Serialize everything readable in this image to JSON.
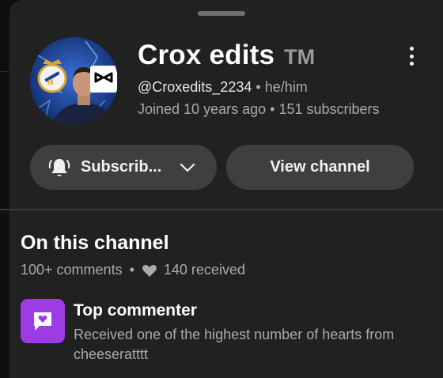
{
  "channel": {
    "name": "Crox edits",
    "tm": "TM",
    "handle": "@Croxedits_2234",
    "separator": "•",
    "pronouns": "he/him",
    "joined": "Joined 10 years ago",
    "subscribers": "151 subscribers",
    "avatar_badge_icon": "capcut-logo-icon"
  },
  "actions": {
    "subscribe_label": "Subscrib...",
    "view_label": "View channel"
  },
  "on_channel": {
    "title": "On this channel",
    "comments": "100+ comments",
    "dot": "•",
    "hearts": "140 received"
  },
  "badge": {
    "title": "Top commenter",
    "description": "Received one of the highest number of hearts from cheeseratttt",
    "color": "#9b3ce6"
  },
  "colors": {
    "sheet": "#212121",
    "button": "#3f3f3f",
    "secondary_text": "#aaaaaa"
  }
}
